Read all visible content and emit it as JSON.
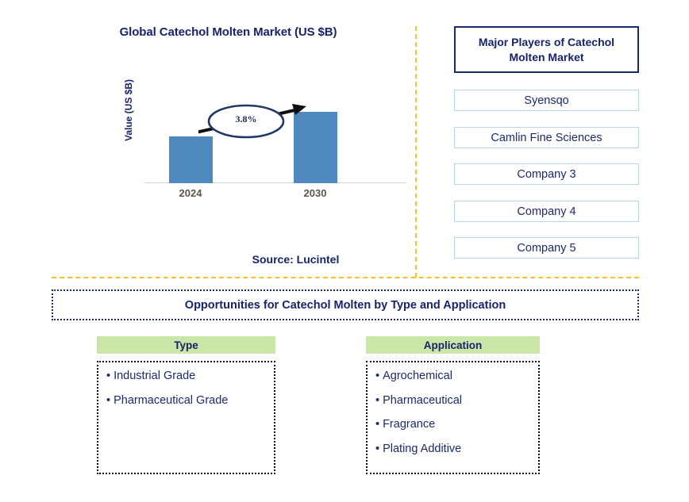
{
  "chart_panel": {
    "title": "Global Catechol Molten Market (US $B)",
    "ylabel": "Value (US $B)",
    "source": "Source: Lucintel",
    "cagr_label": "3.8%"
  },
  "players_panel": {
    "header": "Major Players of Catechol Molten Market",
    "companies": [
      {
        "name": "Syensqo"
      },
      {
        "name": "Camlin Fine Sciences"
      },
      {
        "name": "Company 3"
      },
      {
        "name": "Company 4"
      },
      {
        "name": "Company 5"
      }
    ]
  },
  "opportunities": {
    "banner": "Opportunities for Catechol Molten by Type and Application",
    "columns": [
      {
        "header": "Type",
        "items": [
          {
            "label": "Industrial Grade",
            "bullet": "•"
          },
          {
            "label": "Pharmaceutical Grade",
            "bullet": "•"
          }
        ]
      },
      {
        "header": "Application",
        "items": [
          {
            "label": "Agrochemical",
            "bullet": "•"
          },
          {
            "label": "Pharmaceutical",
            "bullet": "•"
          },
          {
            "label": "Fragrance",
            "bullet": "•"
          },
          {
            "label": "Plating Additive",
            "bullet": "•"
          }
        ]
      }
    ]
  },
  "colors": {
    "bar": "#5089C0",
    "navy_text": "#17236B",
    "divider_amber": "#FFC026",
    "header_green": "#CCE5A8",
    "company_border": "#BBD3E8",
    "tick_label": "#5E5449"
  },
  "chart_data": {
    "type": "bar",
    "title": "Global Catechol Molten Market (US $B)",
    "xlabel": "",
    "ylabel": "Value (US $B)",
    "categories": [
      "2024",
      "2030"
    ],
    "values": [
      59,
      90
    ],
    "value_unit": "relative bar height (US $B, unlabeled axis)",
    "ylim": [
      0,
      100
    ],
    "grid": false,
    "legend": false,
    "annotations": [
      {
        "text": "3.8%",
        "kind": "cagr-callout",
        "from_category": "2024",
        "to_category": "2030"
      }
    ]
  }
}
